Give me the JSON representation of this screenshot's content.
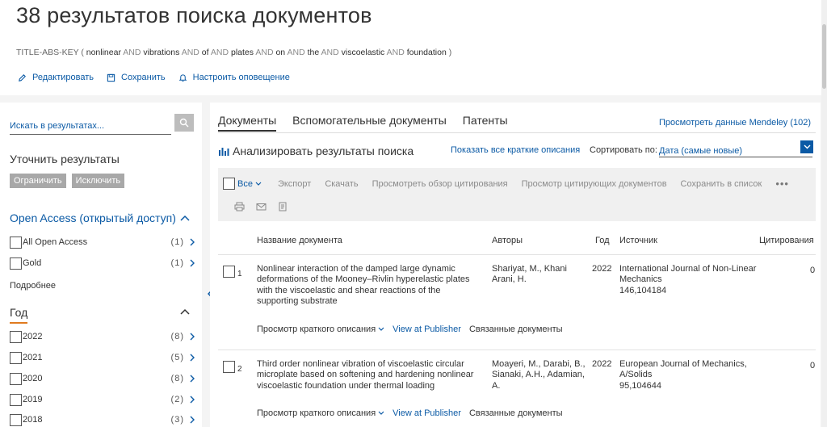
{
  "header": {
    "title": "38 результатов поиска документов",
    "query": {
      "prefix": "TITLE-ABS-KEY (",
      "terms": [
        "nonlinear",
        "vibrations",
        "of",
        "plates",
        "on",
        "the",
        "viscoelastic",
        "foundation"
      ],
      "operator": "AND",
      "suffix": ")"
    },
    "actions": {
      "edit": "Редактировать",
      "save": "Сохранить",
      "alert": "Настроить оповещение"
    }
  },
  "sidebar": {
    "search_placeholder": "Искать в результатах...",
    "refine_title": "Уточнить результаты",
    "limit_label": "Ограничить",
    "exclude_label": "Исключить",
    "open_access": {
      "heading": "Open Access (открытый доступ)",
      "items": [
        {
          "label": "All Open Access",
          "count": "(1)"
        },
        {
          "label": "Gold",
          "count": "(1)"
        }
      ],
      "more": "Подробнее"
    },
    "year": {
      "heading": "Год",
      "items": [
        {
          "label": "2022",
          "count": "(8)"
        },
        {
          "label": "2021",
          "count": "(5)"
        },
        {
          "label": "2020",
          "count": "(8)"
        },
        {
          "label": "2019",
          "count": "(2)"
        },
        {
          "label": "2018",
          "count": "(3)"
        }
      ]
    }
  },
  "main": {
    "tabs": [
      {
        "label": "Документы",
        "active": true
      },
      {
        "label": "Вспомогательные документы",
        "active": false
      },
      {
        "label": "Патенты",
        "active": false
      }
    ],
    "mendeley": "Просмотреть данные Mendeley (102)",
    "analyze": "Анализировать результаты поиска",
    "show_abstracts": "Показать все краткие описания",
    "sort_label": "Сортировать по:",
    "sort_value": "Дата (самые новые)",
    "toolbar": {
      "all": "Все",
      "export": "Экспорт",
      "download": "Скачать",
      "citation_overview": "Просмотреть обзор цитирования",
      "citing_docs": "Просмотр цитирующих документов",
      "save_to_list": "Сохранить в список",
      "more": "•••"
    },
    "columns": {
      "title": "Название документа",
      "authors": "Авторы",
      "year": "Год",
      "source": "Источник",
      "citations": "Цитирования"
    },
    "documents": [
      {
        "num": "1",
        "title": "Nonlinear interaction of the damped large dynamic deformations of the Mooney–Rivlin hyperelastic plates with the viscoelastic and shear reactions of the supporting substrate",
        "authors": "Shariyat, M., Khani Arani, H.",
        "year": "2022",
        "source_name": "International Journal of Non-Linear Mechanics",
        "source_detail": "146,104184",
        "cites": "0",
        "abstract_link": "Просмотр краткого описания",
        "publisher_link": "View at Publisher",
        "related_link": "Связанные документы"
      },
      {
        "num": "2",
        "title": "Third order nonlinear vibration of viscoelastic circular microplate based on softening and hardening nonlinear viscoelastic foundation under thermal loading",
        "authors": "Moayeri, M., Darabi, B., Sianaki, A.H., Adamian, A.",
        "year": "2022",
        "source_name": "European Journal of Mechanics, A/Solids",
        "source_detail": "95,104644",
        "cites": "0",
        "abstract_link": "Просмотр краткого описания",
        "publisher_link": "View at Publisher",
        "related_link": "Связанные документы"
      }
    ]
  }
}
